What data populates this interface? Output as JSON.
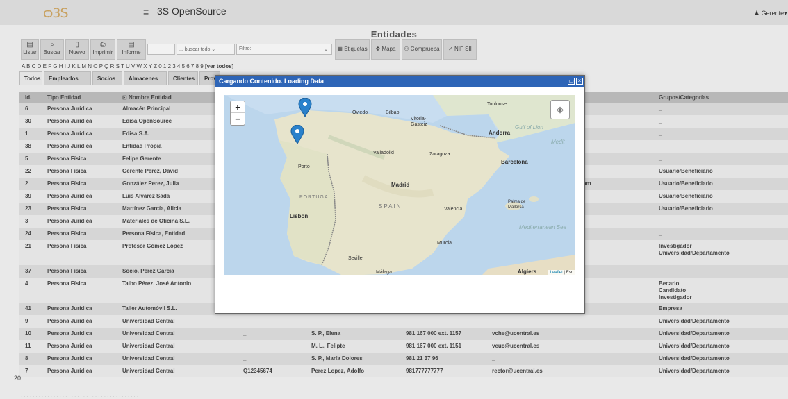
{
  "app": {
    "logo": "ѻ3S",
    "menu_icon": "hamburger-icon",
    "title": "3S OpenSource",
    "user": "Gerente"
  },
  "page": {
    "title": "Entidades"
  },
  "toolbar": {
    "listar": "Listar",
    "buscar": "Buscar",
    "nuevo": "Nuevo",
    "imprimir": "Imprimir",
    "informe": "Informe",
    "search_select": "... buscar todo",
    "filtro": "Filtro:",
    "etiquetas": "Etiquetas",
    "mapa": "Mapa",
    "comprueba": "Comprueba",
    "nifsii": "NIF SII"
  },
  "letters": "A B C D E F G H I J K L M N O P Q R S T U V W X Y Z 0 1 2 3 4 5 6 7 8 9",
  "letters_all": "[ver todos]",
  "tabs": [
    "Todos",
    "Empleados",
    "Socios",
    "Almacenes",
    "Clientes",
    "Prov"
  ],
  "columns": {
    "id": "Id.",
    "tipo": "Tipo Entidad",
    "nombre": "Nombre Entidad",
    "grupos": "Grupos/Categorías"
  },
  "rows": [
    {
      "id": "6",
      "tipo": "Persona Jurídica",
      "nombre": "Almacén Principal",
      "grupos": "_"
    },
    {
      "id": "30",
      "tipo": "Persona Jurídica",
      "nombre": "Edisa OpenSource",
      "grupos": "_"
    },
    {
      "id": "1",
      "tipo": "Persona Jurídica",
      "nombre": "Edisa S.A.",
      "grupos": "_"
    },
    {
      "id": "38",
      "tipo": "Persona Jurídica",
      "nombre": "Entidad Propia",
      "grupos": "_"
    },
    {
      "id": "5",
      "tipo": "Persona Física",
      "nombre": "Felipe Gerente",
      "grupos": "_"
    },
    {
      "id": "22",
      "tipo": "Persona Física",
      "nombre": "Gerente Perez, David",
      "grupos": "Usuario/Beneficiario"
    },
    {
      "id": "2",
      "tipo": "Persona Física",
      "nombre": "González Perez, Julia",
      "extra": ".com",
      "grupos": "Usuario/Beneficiario"
    },
    {
      "id": "39",
      "tipo": "Persona Jurídica",
      "nombre": "Luis Alvárez Sada",
      "grupos": "Usuario/Beneficiario"
    },
    {
      "id": "23",
      "tipo": "Persona Física",
      "nombre": "Martínez García, Alicia",
      "grupos": "Usuario/Beneficiario"
    },
    {
      "id": "3",
      "tipo": "Persona Jurídica",
      "nombre": "Materiales de Oficina S.L.",
      "grupos": "_"
    },
    {
      "id": "24",
      "tipo": "Persona Física",
      "nombre": "Persona Física, Entidad",
      "grupos": "_"
    },
    {
      "id": "21",
      "tipo": "Persona Física",
      "nombre": "Profesor Gómez López",
      "grupos": "Investigador\nUniversidad/Departamento"
    },
    {
      "id": "37",
      "tipo": "Persona Física",
      "nombre": "Socio, Perez García",
      "grupos": "_"
    },
    {
      "id": "4",
      "tipo": "Persona Física",
      "nombre": "Taibo Pérez, José Antonio",
      "grupos": "Becario\nCandidato\nInvestigador"
    },
    {
      "id": "41",
      "tipo": "Persona Jurídica",
      "nombre": "Taller Automóvil S.L.",
      "grupos": "Empresa"
    },
    {
      "id": "9",
      "tipo": "Persona Jurídica",
      "nombre": "Universidad Central",
      "grupos": "Universidad/Departamento"
    },
    {
      "id": "10",
      "tipo": "Persona Jurídica",
      "nombre": "Universidad Central",
      "cif": "_",
      "contacto": "S. P., Elena",
      "tel": "981 167 000 ext. 1157",
      "email": "vche@ucentral.es",
      "grupos": "Universidad/Departamento"
    },
    {
      "id": "11",
      "tipo": "Persona Jurídica",
      "nombre": "Universidad Central",
      "cif": "_",
      "contacto": "M. L., Felipte",
      "tel": "981 167 000 ext. 1151",
      "email": "veuc@ucentral.es",
      "grupos": "Universidad/Departamento"
    },
    {
      "id": "8",
      "tipo": "Persona Jurídica",
      "nombre": "Universidad Central",
      "cif": "_",
      "contacto": "S. P., María Dolores",
      "tel": "981 21 37 96",
      "email": "_",
      "grupos": "Universidad/Departamento"
    },
    {
      "id": "7",
      "tipo": "Persona Jurídica",
      "nombre": "Universidad Central",
      "cif": "Q12345674",
      "contacto": "Perez Lopez, Adolfo",
      "tel": "981777777777",
      "email": "rector@ucentral.es",
      "grupos": "Universidad/Departamento"
    }
  ],
  "count": "20",
  "dialog": {
    "title": "Cargando Contenido. Loading Data",
    "zoom_in": "+",
    "zoom_out": "−",
    "attribution_link": "Leaflet",
    "attribution_rest": " | Esri",
    "labels": [
      "Oviedo",
      "Bilbao",
      "Vitoria-Gasteiz",
      "Toulouse",
      "Andorra",
      "Gulf of Lion",
      "Medit",
      "Valladolid",
      "Zaragoza",
      "Barcelona",
      "Porto",
      "Madrid",
      "PORTUGAL",
      "SPAIN",
      "Valencia",
      "Palma de Mallorca",
      "Lisbon",
      "Mediterranean Sea",
      "Murcia",
      "Seville",
      "Málaga",
      "Algiers"
    ]
  }
}
